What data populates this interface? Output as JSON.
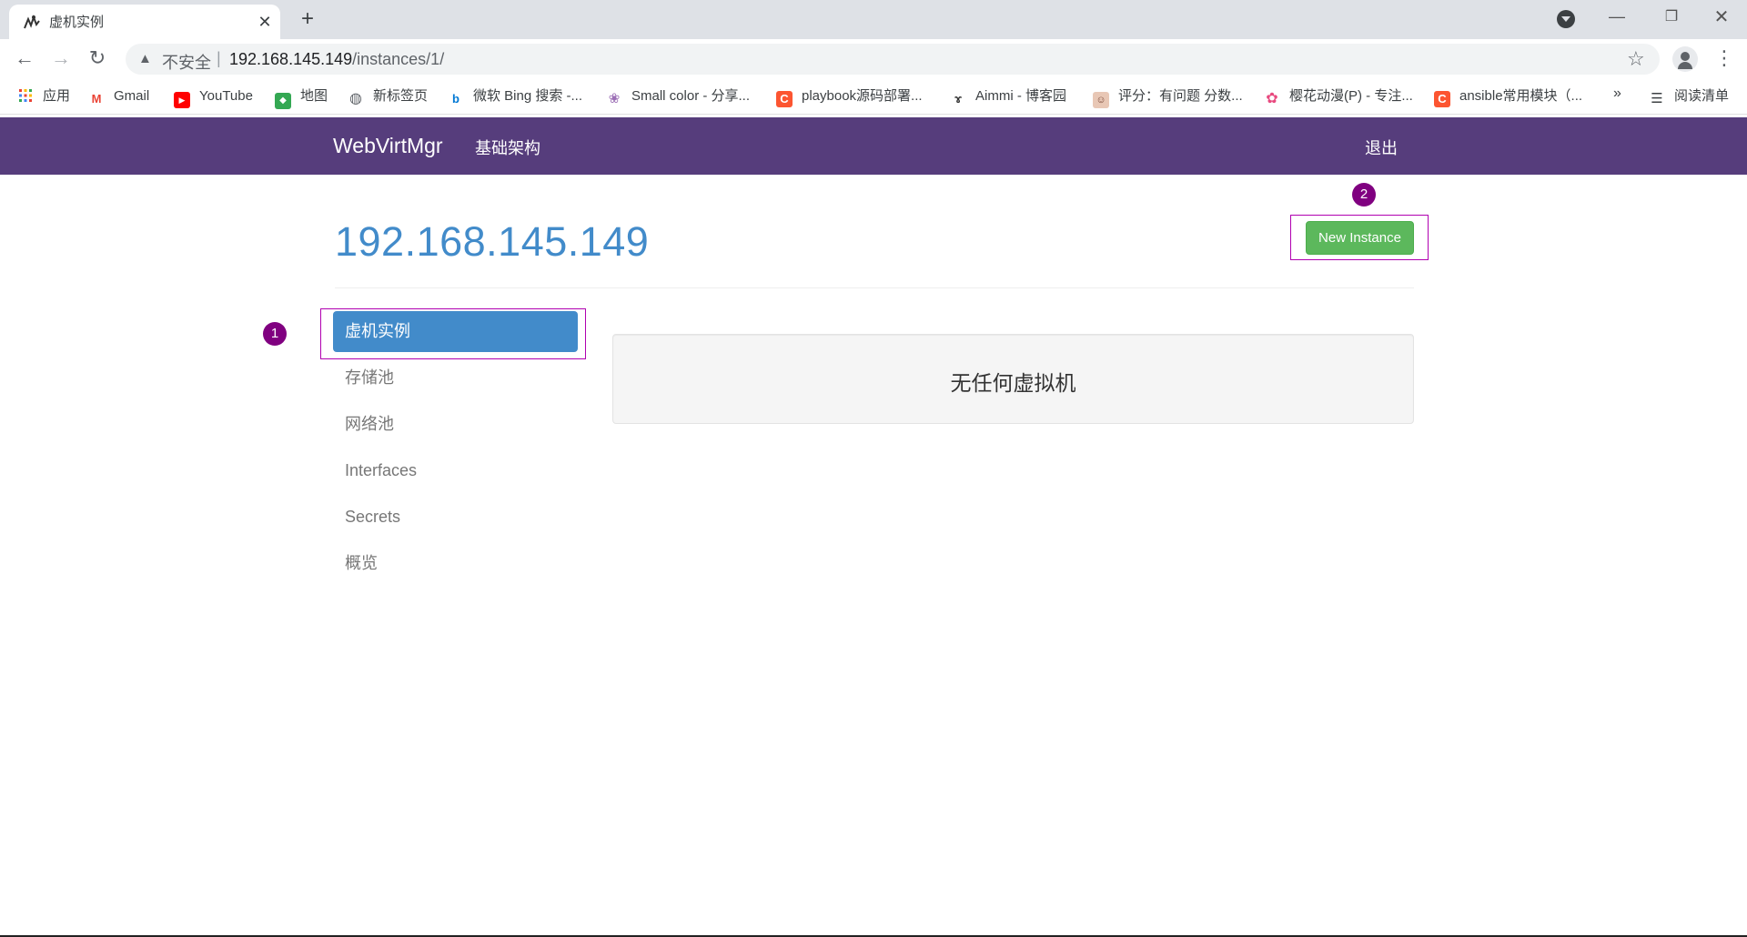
{
  "browser": {
    "tab_title": "虚机实例",
    "tab_favicon": "webvirtmgr-favicon",
    "new_tab_label": "+",
    "url_warning": "不安全",
    "url_separator": "|",
    "url_host": "192.168.145.149",
    "url_path": "/instances/1/"
  },
  "bookmarks": [
    {
      "label": "应用",
      "icon": "apps-grid-icon",
      "color": "#ea4335"
    },
    {
      "label": "Gmail",
      "icon": "gmail-icon",
      "color": "#ea4335"
    },
    {
      "label": "YouTube",
      "icon": "youtube-icon",
      "color": "#ff0000"
    },
    {
      "label": "地图",
      "icon": "maps-icon",
      "color": "#34a853"
    },
    {
      "label": "新标签页",
      "icon": "globe-icon",
      "color": "#5f6368"
    },
    {
      "label": "微软 Bing 搜索 -...",
      "icon": "bing-icon",
      "color": "#0078d4"
    },
    {
      "label": "Small color - 分享...",
      "icon": "smallcolor-icon",
      "color": "#9c6fb6"
    },
    {
      "label": "playbook源码部署...",
      "icon": "csdn-icon",
      "color": "#fc5531"
    },
    {
      "label": "Aimmi - 博客园",
      "icon": "cnblogs-icon",
      "color": "#333333"
    },
    {
      "label": "评分：有问题 分数...",
      "icon": "avatar-icon",
      "color": "#c98b6b"
    },
    {
      "label": "樱花动漫(P) - 专注...",
      "icon": "sakura-icon",
      "color": "#e84a7f"
    },
    {
      "label": "ansible常用模块（...",
      "icon": "csdn-icon",
      "color": "#fc5531"
    }
  ],
  "bookmarks_more": "»",
  "reading_list": "阅读清单",
  "app": {
    "brand": "WebVirtMgr",
    "nav_infrastructure": "基础架构",
    "nav_logout": "退出",
    "host_title": "192.168.145.149",
    "new_instance_button": "New Instance",
    "markers": [
      "1",
      "2"
    ],
    "sidebar": [
      {
        "label": "虚机实例",
        "active": true
      },
      {
        "label": "存储池",
        "active": false
      },
      {
        "label": "网络池",
        "active": false
      },
      {
        "label": "Interfaces",
        "active": false
      },
      {
        "label": "Secrets",
        "active": false
      },
      {
        "label": "概览",
        "active": false
      }
    ],
    "empty_message": "无任何虚拟机"
  },
  "colors": {
    "navbar": "#563d7c",
    "title": "#428bca",
    "active": "#428bca",
    "success": "#5cb85c",
    "annotation": "#800080"
  }
}
